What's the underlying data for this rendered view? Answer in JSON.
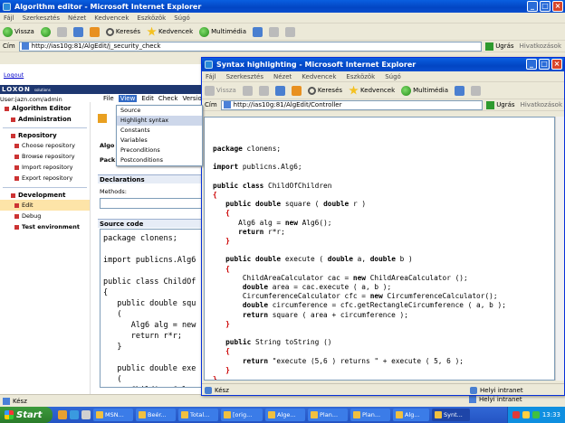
{
  "bg_window": {
    "title": "Algorithm editor - Microsoft Internet Explorer",
    "menu": [
      "Fájl",
      "Szerkesztés",
      "Nézet",
      "Kedvencek",
      "Eszközök",
      "Súgó"
    ],
    "toolbar": {
      "back": "Vissza",
      "search": "Keresés",
      "favorites": "Kedvencek",
      "media": "Multimédia"
    },
    "address_label": "Cím",
    "address": "http://ias10g:81/AlgEdit/j_security_check",
    "go": "Ugrás",
    "links": "Hivatkozások",
    "status": "Kész",
    "zone": "Helyi intranet"
  },
  "page": {
    "logout": "Logout",
    "brand": "LOXON",
    "brand_sub": "solutions",
    "user": "User:jazn.com/admin",
    "sidebar": {
      "algorithm_editor": "Algorithm Editor",
      "administration": "Administration",
      "repository": "Repository",
      "repo_items": [
        "Choose repository",
        "Browse repository",
        "Import repository",
        "Export repository"
      ],
      "development": "Development",
      "dev_items": [
        "Edit",
        "Debug",
        "Test environment"
      ]
    },
    "appmenu": [
      "File",
      "View",
      "Edit",
      "Check",
      "Version"
    ],
    "view_menu": [
      "Source",
      "Highlight syntax",
      "Constants",
      "Variables",
      "Preconditions",
      "Postconditions"
    ],
    "algo_label": "Algo",
    "pack_label": "Pack",
    "declarations": "Declarations",
    "methods": "Methods:",
    "source_code": "Source code",
    "source_lines": [
      "package clonens;",
      "",
      "import publicns.Alg6",
      "",
      "public class ChildOf",
      "{",
      "   public double squ",
      "   (",
      "      Alg6 alg = new",
      "      return r*r;",
      "   }",
      "",
      "   public double exe",
      "   (",
      "      ChildAreaCalc",
      "      double area ="
    ]
  },
  "popup": {
    "title": "Syntax highlighting - Microsoft Internet Explorer",
    "menu": [
      "Fájl",
      "Szerkesztés",
      "Nézet",
      "Kedvencek",
      "Eszközök",
      "Súgó"
    ],
    "toolbar": {
      "back": "Vissza",
      "search": "Keresés",
      "favorites": "Kedvencek",
      "media": "Multimédia"
    },
    "address_label": "Cím",
    "address": "http://ias10g:81/AlgEdit/Controller",
    "go": "Ugrás",
    "links": "Hivatkozások",
    "status": "Kész",
    "zone": "Helyi intranet"
  },
  "taskbar": {
    "start": "Start",
    "tasks": [
      "MSN...",
      "Beér...",
      "Total...",
      "[orig...",
      "Alge...",
      "Plan...",
      "Plan...",
      "Alg...",
      "Synt..."
    ],
    "clock": "13:33"
  }
}
